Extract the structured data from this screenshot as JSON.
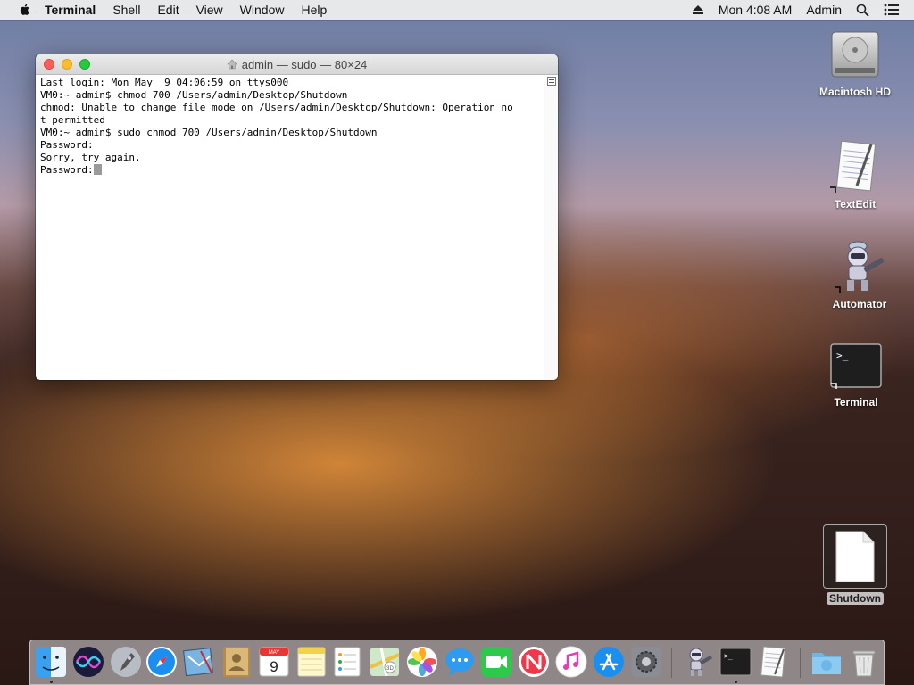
{
  "menubar": {
    "app_name": "Terminal",
    "items": [
      "Shell",
      "Edit",
      "View",
      "Window",
      "Help"
    ],
    "clock": "Mon 4:08 AM",
    "user": "Admin"
  },
  "window": {
    "title": "admin — sudo — 80×24",
    "lines": [
      "Last login: Mon May  9 04:06:59 on ttys000",
      "VM0:~ admin$ chmod 700 /Users/admin/Desktop/Shutdown",
      "chmod: Unable to change file mode on /Users/admin/Desktop/Shutdown: Operation no",
      "t permitted",
      "VM0:~ admin$ sudo chmod 700 /Users/admin/Desktop/Shutdown",
      "Password:",
      "Sorry, try again.",
      "Password:"
    ]
  },
  "desktop": {
    "icons": [
      "Macintosh HD",
      "TextEdit",
      "Automator",
      "Terminal",
      "Shutdown"
    ]
  },
  "dock": {
    "apps": [
      "finder-icon",
      "siri-icon",
      "launchpad-icon",
      "safari-icon",
      "mail-icon",
      "contacts-icon",
      "calendar-icon",
      "notes-icon",
      "reminders-icon",
      "maps-icon",
      "photos-icon",
      "messages-icon",
      "facetime-icon",
      "news-icon",
      "itunes-icon",
      "app-store-icon",
      "system-preferences-icon",
      "automator-icon",
      "terminal-icon",
      "textedit-icon",
      "downloads-folder-icon",
      "trash-icon"
    ],
    "calendar_month": "MAY",
    "calendar_day": "9"
  }
}
